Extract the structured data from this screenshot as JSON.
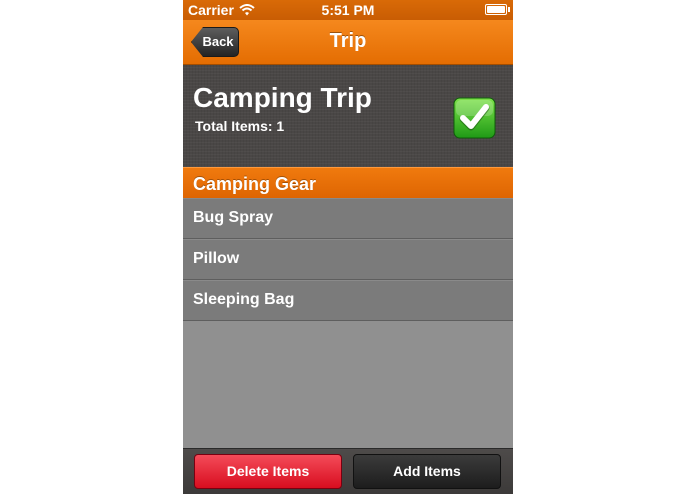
{
  "status_bar": {
    "carrier": "Carrier",
    "time": "5:51 PM",
    "wifi_icon": "wifi-icon",
    "battery_icon": "battery-icon"
  },
  "nav": {
    "back_label": "Back",
    "title": "Trip"
  },
  "trip": {
    "name": "Camping Trip",
    "total_label": "Total Items: 1",
    "checked": true,
    "check_icon": "checkmark-icon"
  },
  "section": {
    "title": "Camping Gear"
  },
  "items": [
    {
      "label": "Bug Spray"
    },
    {
      "label": "Pillow"
    },
    {
      "label": "Sleeping Bag"
    }
  ],
  "toolbar": {
    "delete_label": "Delete Items",
    "add_label": "Add Items"
  },
  "colors": {
    "accent": "#e87207",
    "delete": "#e01526",
    "header_bg": "#4a4746",
    "list_bg": "#7b7b7b"
  }
}
